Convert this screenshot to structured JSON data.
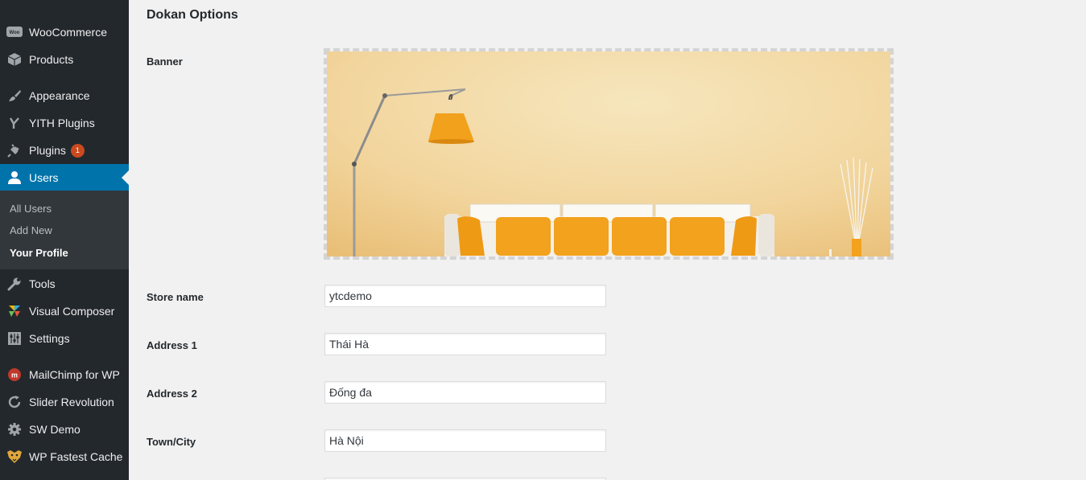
{
  "sidebar": {
    "items": [
      {
        "label": "WooCommerce",
        "icon": "woocommerce-icon"
      },
      {
        "label": "Products",
        "icon": "products-box-icon"
      },
      {
        "label": "Appearance",
        "icon": "paintbrush-icon"
      },
      {
        "label": "YITH Plugins",
        "icon": "yith-icon"
      },
      {
        "label": "Plugins",
        "icon": "plugin-plug-icon",
        "badge": "1"
      },
      {
        "label": "Users",
        "icon": "user-icon"
      },
      {
        "label": "Tools",
        "icon": "wrench-icon"
      },
      {
        "label": "Visual Composer",
        "icon": "visual-composer-icon"
      },
      {
        "label": "Settings",
        "icon": "settings-sliders-icon"
      },
      {
        "label": "MailChimp for WP",
        "icon": "mailchimp-icon"
      },
      {
        "label": "Slider Revolution",
        "icon": "refresh-icon"
      },
      {
        "label": "SW Demo",
        "icon": "gear-icon"
      },
      {
        "label": "WP Fastest Cache",
        "icon": "cheetah-icon"
      }
    ],
    "users_submenu": [
      "All Users",
      "Add New",
      "Your Profile"
    ]
  },
  "section": {
    "title": "Dokan Options"
  },
  "form": {
    "banner_label": "Banner",
    "store_name_label": "Store name",
    "store_name_value": "ytcdemo",
    "address1_label": "Address 1",
    "address1_value": "Thái Hà",
    "address2_label": "Address 2",
    "address2_value": "Đống đa",
    "city_label": "Town/City",
    "city_value": "Hà Nội"
  },
  "colors": {
    "sidebar": "#23282d",
    "active": "#0073aa",
    "badge": "#ca4a1f",
    "background": "#f1f1f1"
  }
}
